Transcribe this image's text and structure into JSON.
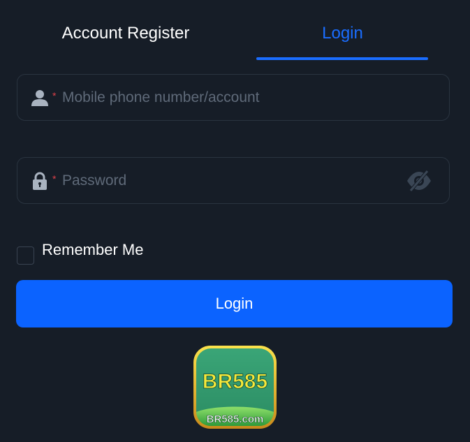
{
  "tabs": {
    "register_label": "Account Register",
    "login_label": "Login",
    "active": "login"
  },
  "account_field": {
    "placeholder": "Mobile phone number/account",
    "required_mark": "*",
    "icon": "user-icon"
  },
  "password_field": {
    "placeholder": "Password",
    "required_mark": "*",
    "icon": "lock-icon",
    "toggle_icon": "eye-off-icon"
  },
  "remember": {
    "label": "Remember Me",
    "checked": false
  },
  "login_button": {
    "label": "Login"
  },
  "logo": {
    "main_text": "BR585",
    "sub_text": "BR585.com"
  },
  "colors": {
    "background": "#161d27",
    "accent": "#0b63ff",
    "tab_active": "#1a6dff",
    "placeholder": "#5f6a79",
    "required": "#e0424a"
  }
}
